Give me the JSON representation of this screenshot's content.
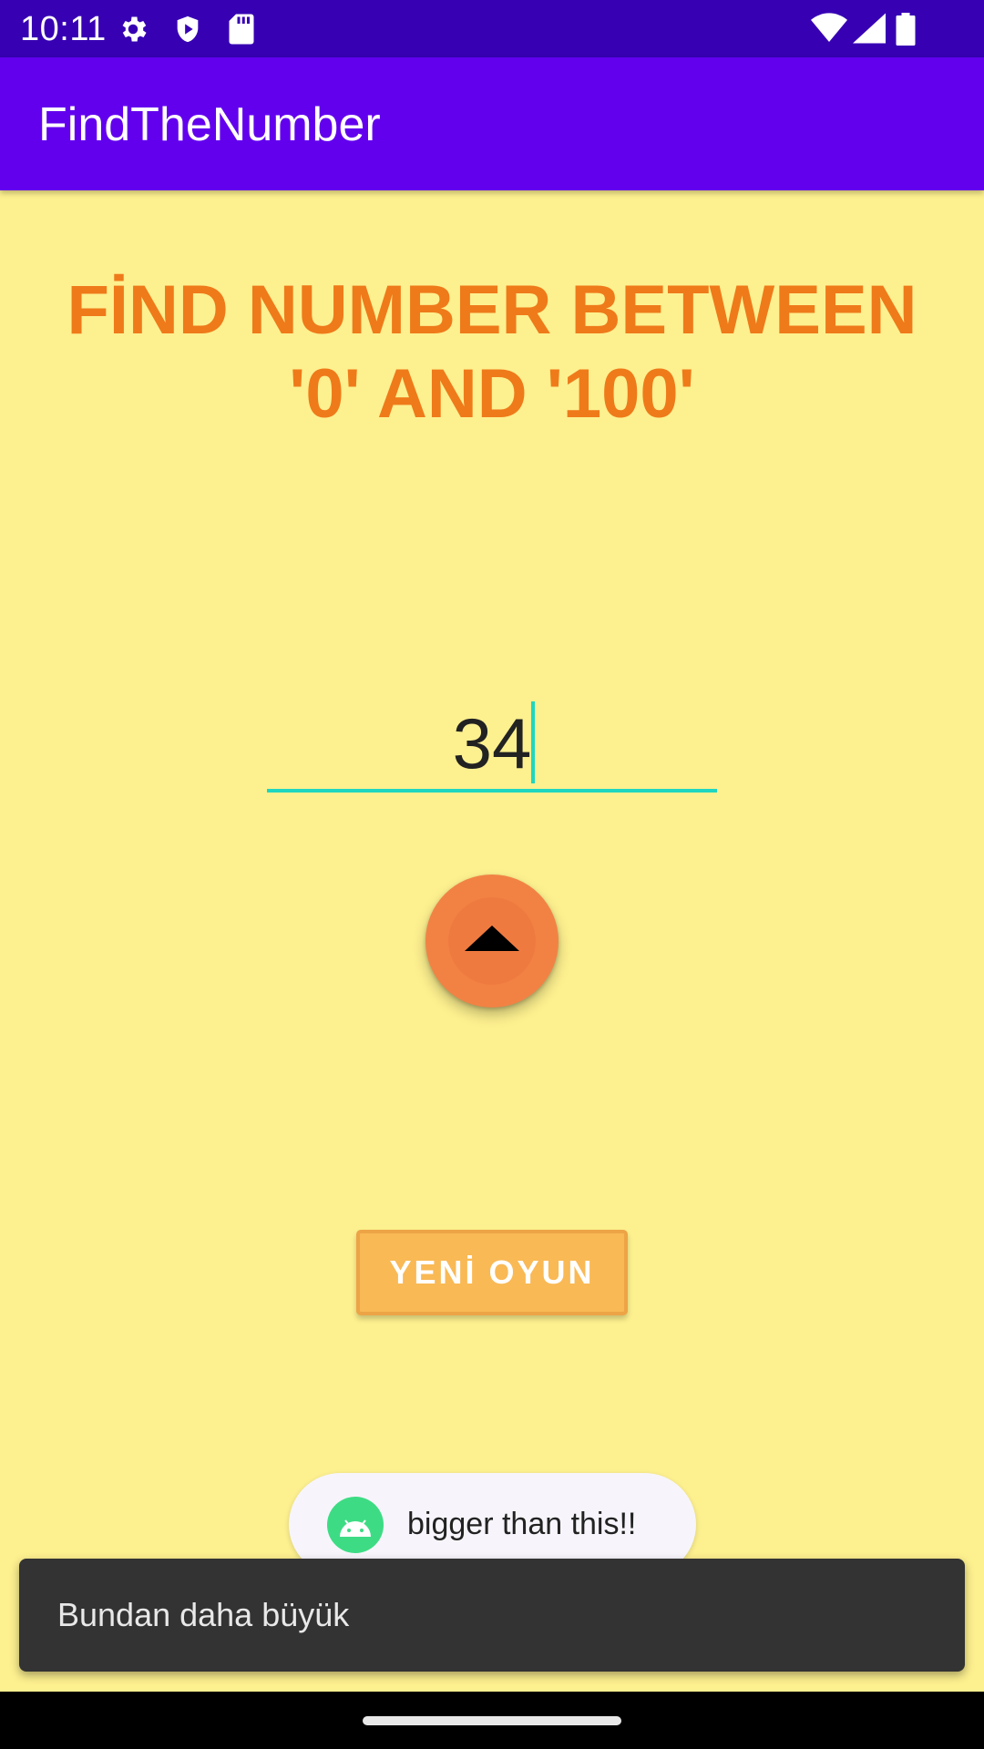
{
  "status_bar": {
    "time": "10:11",
    "icons": [
      "gear-icon",
      "shield-icon",
      "sd-card-icon",
      "wifi-icon",
      "signal-icon",
      "battery-icon"
    ]
  },
  "app_bar": {
    "title": "FindTheNumber",
    "color": "#6200ee"
  },
  "main": {
    "heading_line1": "FİND NUMBER BETWEEN",
    "heading_line2": "'0' AND '100'",
    "guess_value": "34",
    "fab_icon": "arrow-up-icon",
    "new_game_label": "YENİ OYUN"
  },
  "toast": {
    "icon": "android-icon",
    "text": "bigger than this!!"
  },
  "snackbar": {
    "text": "Bundan daha büyük"
  },
  "colors": {
    "background": "#fdf08f",
    "heading": "#ef7a1a",
    "accent_teal": "#1fd6c0",
    "fab": "#f28244",
    "button": "#f9b955",
    "status_bar": "#3700b3"
  }
}
